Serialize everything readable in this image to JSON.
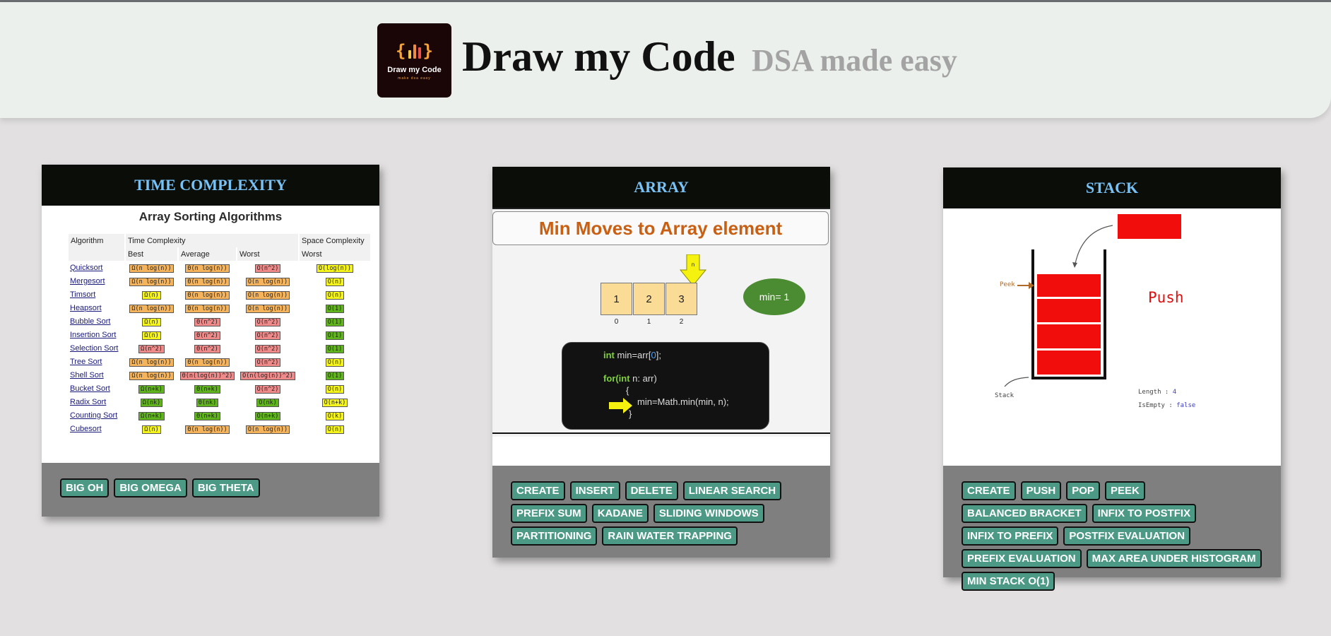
{
  "header": {
    "brand": "Draw my Code",
    "tagline": "DSA made easy",
    "logo": {
      "mark_left": "{",
      "mark_right": "}",
      "name": "Draw my Code",
      "tag": "make dsa easy"
    }
  },
  "cards": {
    "time_complexity": {
      "title": "TIME COMPLEXITY",
      "preview": {
        "heading": "Array Sorting Algorithms",
        "columns": {
          "algorithm": "Algorithm",
          "time": "Time Complexity",
          "space": "Space Complexity"
        },
        "subcolumns": {
          "best": "Best",
          "average": "Average",
          "worst": "Worst",
          "space_worst": "Worst"
        },
        "rows": [
          {
            "name": "Quicksort",
            "best": "Ω(n log(n))",
            "avg": "Θ(n log(n))",
            "worst": "O(n^2)",
            "space": "O(log(n))"
          },
          {
            "name": "Mergesort",
            "best": "Ω(n log(n))",
            "avg": "Θ(n log(n))",
            "worst": "O(n log(n))",
            "space": "O(n)"
          },
          {
            "name": "Timsort",
            "best": "Ω(n)",
            "avg": "Θ(n log(n))",
            "worst": "O(n log(n))",
            "space": "O(n)"
          },
          {
            "name": "Heapsort",
            "best": "Ω(n log(n))",
            "avg": "Θ(n log(n))",
            "worst": "O(n log(n))",
            "space": "O(1)"
          },
          {
            "name": "Bubble Sort",
            "best": "Ω(n)",
            "avg": "Θ(n^2)",
            "worst": "O(n^2)",
            "space": "O(1)"
          },
          {
            "name": "Insertion Sort",
            "best": "Ω(n)",
            "avg": "Θ(n^2)",
            "worst": "O(n^2)",
            "space": "O(1)"
          },
          {
            "name": "Selection Sort",
            "best": "Ω(n^2)",
            "avg": "Θ(n^2)",
            "worst": "O(n^2)",
            "space": "O(1)"
          },
          {
            "name": "Tree Sort",
            "best": "Ω(n log(n))",
            "avg": "Θ(n log(n))",
            "worst": "O(n^2)",
            "space": "O(n)"
          },
          {
            "name": "Shell Sort",
            "best": "Ω(n log(n))",
            "avg": "Θ(n(log(n))^2)",
            "worst": "O(n(log(n))^2)",
            "space": "O(1)"
          },
          {
            "name": "Bucket Sort",
            "best": "Ω(n+k)",
            "avg": "Θ(n+k)",
            "worst": "O(n^2)",
            "space": "O(n)"
          },
          {
            "name": "Radix Sort",
            "best": "Ω(nk)",
            "avg": "Θ(nk)",
            "worst": "O(nk)",
            "space": "O(n+k)"
          },
          {
            "name": "Counting Sort",
            "best": "Ω(n+k)",
            "avg": "Θ(n+k)",
            "worst": "O(n+k)",
            "space": "O(k)"
          },
          {
            "name": "Cubesort",
            "best": "Ω(n)",
            "avg": "Θ(n log(n))",
            "worst": "O(n log(n))",
            "space": "O(n)"
          }
        ]
      },
      "buttons": [
        "BIG OH",
        "BIG OMEGA",
        "BIG THETA"
      ]
    },
    "array": {
      "title": "ARRAY",
      "preview": {
        "heading": "Min Moves to Array element",
        "cells": [
          "1",
          "2",
          "3"
        ],
        "indices": [
          "0",
          "1",
          "2"
        ],
        "pointer_label": "n",
        "min_label": "min= 1",
        "code": {
          "l1_kw": "int",
          "l1_a": " min=arr[",
          "l1_num": "0",
          "l1_b": "];",
          "l2_kw": "for(int",
          "l2_rest": " n: arr)",
          "l3": "{",
          "l4": "min=Math.min(min, n);",
          "l5": "}"
        }
      },
      "buttons": [
        "CREATE",
        "INSERT",
        "DELETE",
        "LINEAR SEARCH",
        "PREFIX SUM",
        "KADANE",
        "SLIDING WINDOWS",
        "PARTITIONING",
        "RAIN WATER TRAPPING"
      ]
    },
    "stack": {
      "title": "STACK",
      "preview": {
        "operation": "Push",
        "peek_label": "Peek",
        "stack_label": "Stack",
        "length_label": "Length  :",
        "length_value": "4",
        "isempty_label": "IsEmpty :",
        "isempty_value": "false",
        "element_color": "#f20d0d"
      },
      "buttons": [
        "CREATE",
        "PUSH",
        "POP",
        "PEEK",
        "BALANCED BRACKET",
        "INFIX TO POSTFIX",
        "INFIX TO PREFIX",
        "POSTFIX EVALUATION",
        "PREFIX EVALUATION",
        "MAX AREA UNDER HISTOGRAM",
        "MIN STACK O(1)"
      ]
    }
  },
  "colors": {
    "chip": "#4c9a86",
    "card_header": "#0b0d08",
    "card_title": "#78c2f6",
    "footer": "#7f7f7f",
    "accent_orange": "#c85f12"
  }
}
